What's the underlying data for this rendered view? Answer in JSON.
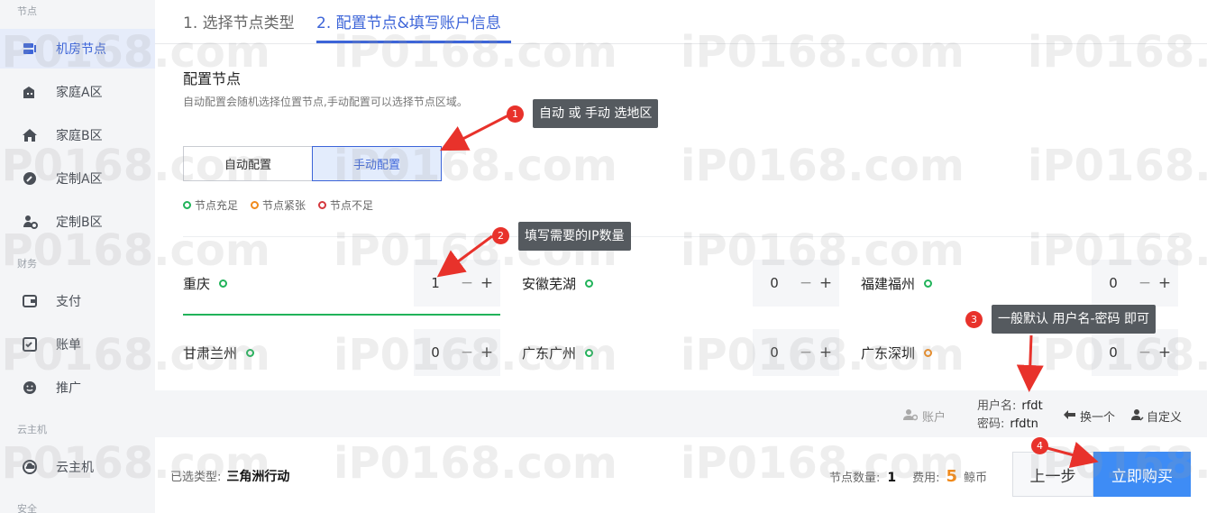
{
  "sidebar": {
    "sections": {
      "nodes": "节点",
      "finance": "财务",
      "cloud": "云主机",
      "security": "安全"
    },
    "items": [
      {
        "label": "机房节点",
        "icon": "server-icon",
        "active": true
      },
      {
        "label": "家庭A区",
        "icon": "building-icon"
      },
      {
        "label": "家庭B区",
        "icon": "home-icon"
      },
      {
        "label": "定制A区",
        "icon": "wrench-icon"
      },
      {
        "label": "定制B区",
        "icon": "gear-user-icon"
      },
      {
        "label": "支付",
        "icon": "wallet-icon"
      },
      {
        "label": "账单",
        "icon": "bill-icon"
      },
      {
        "label": "推广",
        "icon": "smile-icon"
      },
      {
        "label": "云主机",
        "icon": "cloud-icon"
      }
    ]
  },
  "steps": {
    "step1": "1. 选择节点类型",
    "step2": "2. 配置节点&填写账户信息"
  },
  "config": {
    "title": "配置节点",
    "desc": "自动配置会随机选择位置节点,手动配置可以选择节点区域。",
    "auto_label": "自动配置",
    "manual_label": "手动配置"
  },
  "legend": {
    "sufficient": "节点充足",
    "tight": "节点紧张",
    "insufficient": "节点不足"
  },
  "regions": [
    {
      "name": "重庆",
      "qty": "1",
      "status": "sufficient"
    },
    {
      "name": "安徽芜湖",
      "qty": "0",
      "status": "sufficient"
    },
    {
      "name": "福建福州",
      "qty": "0",
      "status": "sufficient"
    },
    {
      "name": "甘肃兰州",
      "qty": "0",
      "status": "sufficient"
    },
    {
      "name": "广东广州",
      "qty": "0",
      "status": "sufficient"
    },
    {
      "name": "广东深圳",
      "qty": "0",
      "status": "tight"
    }
  ],
  "stepper": {
    "minus": "−",
    "plus": "+"
  },
  "account": {
    "label": "账户",
    "username_label": "用户名:",
    "username": "rfdt",
    "password_label": "密码:",
    "password": "rfdtn",
    "change": "换一个",
    "custom": "自定义"
  },
  "bottom": {
    "selected_type_label": "已选类型:",
    "selected_type": "三角洲行动",
    "node_count_label": "节点数量:",
    "node_count": "1",
    "fee_label": "费用:",
    "fee": "5",
    "currency": "鲸币",
    "prev": "上一步",
    "buy": "立即购买"
  },
  "annotations": [
    {
      "num": "1",
      "text": "自动 或 手动 选地区"
    },
    {
      "num": "2",
      "text": "填写需要的IP数量"
    },
    {
      "num": "3",
      "text": "一般默认 用户名-密码 即可"
    },
    {
      "num": "4",
      "text": ""
    }
  ],
  "watermark": "iP0168.com",
  "colors": {
    "accent": "#3c64d8",
    "green": "#21b35a",
    "orange": "#f08a1c",
    "red": "#d4383e",
    "buy": "#3e8cf5"
  }
}
